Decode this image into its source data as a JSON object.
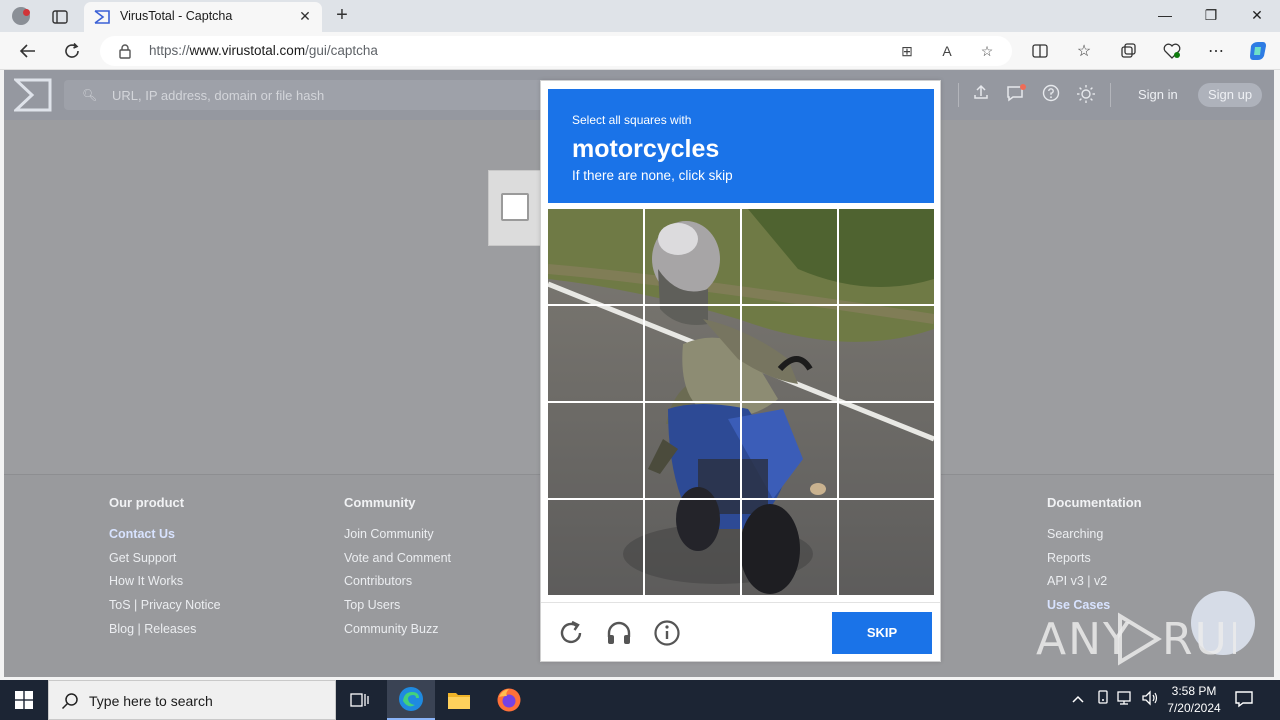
{
  "browser": {
    "tab_title": "VirusTotal - Captcha",
    "new_tab_symbol": "+",
    "url_prefix": "https://",
    "url_domain": "www.virustotal.com",
    "url_path": "/gui/captcha",
    "window_controls": {
      "minimize": "—",
      "maximize": "❐",
      "close": "✕"
    }
  },
  "virustotal": {
    "search_placeholder": "URL, IP address, domain or file hash",
    "sign_in": "Sign in",
    "sign_up": "Sign up",
    "footer": {
      "columns": [
        {
          "heading": "Our product",
          "links": [
            "Contact Us",
            "Get Support",
            "How It Works",
            "ToS | Privacy Notice",
            "Blog | Releases"
          ]
        },
        {
          "heading": "Community",
          "links": [
            "Join Community",
            "Vote and Comment",
            "Contributors",
            "Top Users",
            "Community Buzz"
          ]
        },
        {
          "heading": "Documentation",
          "links": [
            "Searching",
            "Reports",
            "API v3 | v2",
            "Use Cases"
          ]
        }
      ]
    }
  },
  "captcha": {
    "instruction": "Select all squares with",
    "target": "motorcycles",
    "hint": "If there are none, click skip",
    "skip_label": "SKIP",
    "grid_size": 4
  },
  "watermark": {
    "text": "ANY RUN"
  },
  "taskbar": {
    "search_placeholder": "Type here to search",
    "time": "3:58 PM",
    "date": "7/20/2024"
  },
  "colors": {
    "captcha_blue": "#1a73e8",
    "page_overlay": "#9c9da0",
    "taskbar": "#1c2534"
  }
}
